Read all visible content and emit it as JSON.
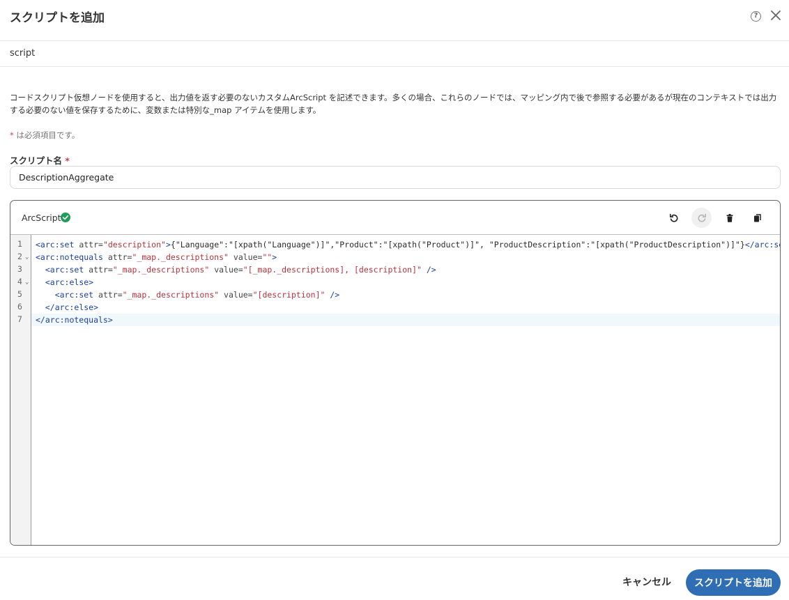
{
  "dialog": {
    "title": "スクリプトを追加",
    "subtitle": "script",
    "description": "コードスクリプト仮想ノードを使用すると、出力値を返す必要のないカスタムArcScript を記述できます。多くの場合、これらのノードでは、マッピング内で後で参照する必要があるが現在のコンテキストでは出力する必要のない値を保存するために、変数または特別な_map アイテムを使用します。",
    "required_star": "*",
    "required_note": " は必須項目です。"
  },
  "icons": {
    "help": "help-circle-icon",
    "close": "close-icon",
    "valid": "check-circle-icon",
    "undo": "undo-icon",
    "redo": "redo-icon",
    "delete": "trash-icon",
    "copy": "copy-icon"
  },
  "form": {
    "name_label": "スクリプト名",
    "name_value": "DescriptionAggregate"
  },
  "editor": {
    "title": "ArcScript",
    "line_numbers": [
      "1",
      "2",
      "3",
      "4",
      "5",
      "6",
      "7"
    ],
    "lines": [
      [
        {
          "t": "tag",
          "v": "<arc:set"
        },
        {
          "t": "attr",
          "v": " attr="
        },
        {
          "t": "str",
          "v": "\"description\""
        },
        {
          "t": "tag",
          "v": ">"
        },
        {
          "t": "txt",
          "v": "{\"Language\":\"[xpath(\"Language\")]\",\"Product\":\"[xpath(\"Product\")]\", \"ProductDescription\":\"[xpath(\"ProductDescription\")]\"}"
        },
        {
          "t": "tag",
          "v": "</arc:set>"
        }
      ],
      [
        {
          "t": "tag",
          "v": "<arc:notequals"
        },
        {
          "t": "attr",
          "v": " attr="
        },
        {
          "t": "str",
          "v": "\"_map._descriptions\""
        },
        {
          "t": "attr",
          "v": " value="
        },
        {
          "t": "str",
          "v": "\"\""
        },
        {
          "t": "tag",
          "v": ">"
        }
      ],
      [
        {
          "t": "txt",
          "v": "  "
        },
        {
          "t": "tag",
          "v": "<arc:set"
        },
        {
          "t": "attr",
          "v": " attr="
        },
        {
          "t": "str",
          "v": "\"_map._descriptions\""
        },
        {
          "t": "attr",
          "v": " value="
        },
        {
          "t": "str",
          "v": "\"[_map._descriptions], [description]\""
        },
        {
          "t": "tag",
          "v": " />"
        }
      ],
      [
        {
          "t": "txt",
          "v": "  "
        },
        {
          "t": "tag",
          "v": "<arc:else>"
        }
      ],
      [
        {
          "t": "txt",
          "v": "    "
        },
        {
          "t": "tag",
          "v": "<arc:set"
        },
        {
          "t": "attr",
          "v": " attr="
        },
        {
          "t": "str",
          "v": "\"_map._descriptions\""
        },
        {
          "t": "attr",
          "v": " value="
        },
        {
          "t": "str",
          "v": "\"[description]\""
        },
        {
          "t": "tag",
          "v": " />"
        }
      ],
      [
        {
          "t": "txt",
          "v": "  "
        },
        {
          "t": "tag",
          "v": "</arc:else>"
        }
      ],
      [
        {
          "t": "tag",
          "v": "</arc:notequals>"
        }
      ]
    ]
  },
  "footer": {
    "cancel_label": "キャンセル",
    "submit_label": "スクリプトを追加"
  },
  "colors": {
    "primary": "#2f6db5",
    "valid": "#1f9d55",
    "required": "#c8414b",
    "code_tag": "#1a3fa6",
    "code_string": "#b8323a"
  }
}
